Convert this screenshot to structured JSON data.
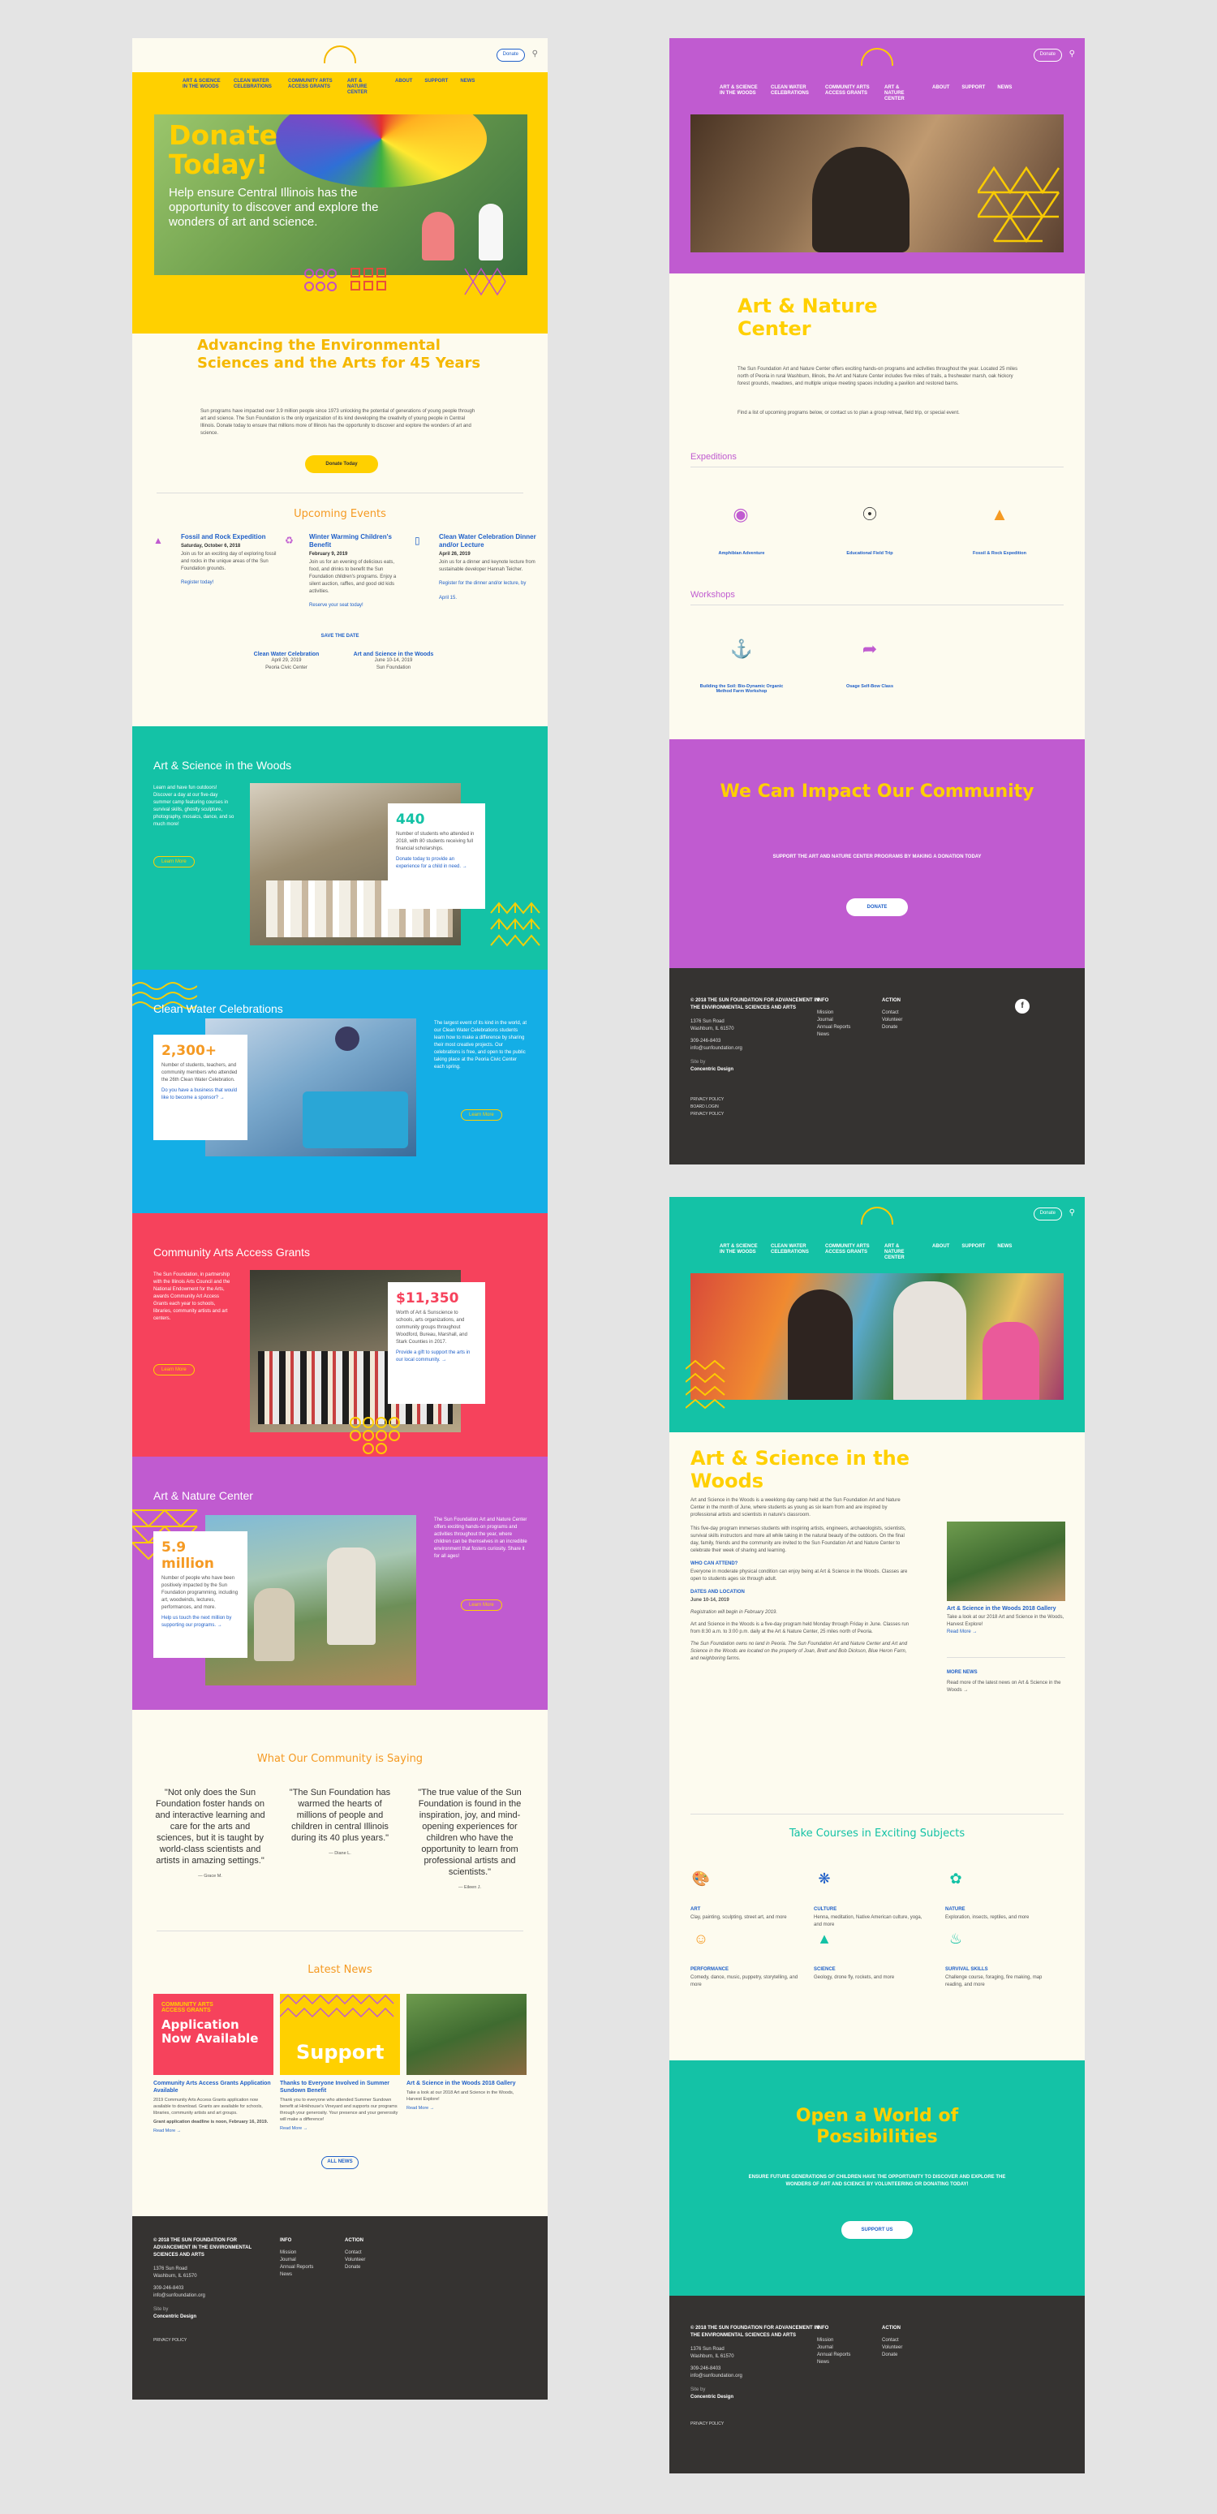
{
  "nav": [
    "Art & Science in the Woods",
    "Clean Water Celebrations",
    "Community Arts Access Grants",
    "Art & Nature Center",
    "About",
    "Support",
    "News"
  ],
  "header": {
    "donate": "Donate",
    "search_icon": "search-icon"
  },
  "p1": {
    "hero_title": "Donate Today!",
    "hero_text": "Help ensure Central Illinois has the opportunity to discover and explore the wonders of art and science.",
    "intro_title": "Advancing the Environmental Sciences and the Arts for 45 Years",
    "intro_text": "Sun programs have impacted over 3.9 million people since 1973 unlocking the potential of generations of young people through art and science. The Sun Foundation is the only organization of its kind developing the creativity of young people in Central Illinois. Donate today to ensure that millions more of Illinois has the opportunity to discover and explore the wonders of art and science.",
    "donate_button": "Donate Today",
    "events_title": "Upcoming Events",
    "events": [
      {
        "title": "Fossil and Rock Expedition",
        "date": "Saturday, October 6, 2018",
        "text": "Join us for an exciting day of exploring fossil and rocks in the unique areas of the Sun Foundation grounds.",
        "link": "Register today!"
      },
      {
        "title": "Winter Warming Children's Benefit",
        "date": "February 9, 2019",
        "text": "Join us for an evening of delicious eats, food, and drinks to benefit the Sun Foundation children's programs. Enjoy a silent auction, raffles, and good old kids activities.",
        "link": "Reserve your seat today!"
      },
      {
        "title": "Clean Water Celebration Dinner and/or Lecture",
        "date": "April 26, 2019",
        "text": "Join us for a dinner and keynote lecture from sustainable developer Hannah Teicher.",
        "link": "Register for the dinner and/or lecture, by April 15."
      }
    ],
    "save_date": "Save the Date",
    "dates": [
      {
        "title": "Clean Water Celebration",
        "date": "April 29, 2019",
        "place": "Peoria Civic Center"
      },
      {
        "title": "Art and Science in the Woods",
        "date": "June 10-14, 2019",
        "place": "Sun Foundation"
      }
    ],
    "band1": {
      "title": "Art & Science in the Woods",
      "text": "Learn and have fun outdoors! Discover a day at our five-day summer camp featuring courses in survival skills, ghostly sculpture, photography, mosaics, dance, and so much more!",
      "button": "Learn More",
      "stat": "440",
      "stat_text": "Number of students who attended in 2018, with 80 students receiving full financial scholarships.",
      "stat_link": "Donate today to provide an experience for a child in need. →"
    },
    "band2": {
      "title": "Clean Water Celebrations",
      "stat": "2,300+",
      "stat_text": "Number of students, teachers, and community members who attended the 26th Clean Water Celebration.",
      "stat_link": "Do you have a business that would like to become a sponsor? →",
      "text": "The largest event of its kind in the world, at our Clean Water Celebrations students learn how to make a difference by sharing their most creative projects. Our celebrations is free, and open to the public taking place at the Peoria Civic Center each spring.",
      "button": "Learn More"
    },
    "band3": {
      "title": "Community Arts Access Grants",
      "text": "The Sun Foundation, in partnership with the Illinois Arts Council and the National Endowment for the Arts, awards Community Art Access Grants each year to schools, libraries, community artists and art centers.",
      "button": "Learn More",
      "stat": "$11,350",
      "stat_text": "Worth of Art & Sunscience to schools, arts organizations, and community groups throughout Woodford, Bureau, Marshall, and Stark Counties in 2017.",
      "stat_link": "Provide a gift to support the arts in our local community. →"
    },
    "band4": {
      "title": "Art & Nature Center",
      "stat": "5.9 million",
      "stat_text": "Number of people who have been positively impacted by the Sun Foundation programming, including art, woodwinds, lectures, performances, and more.",
      "stat_link": "Help us touch the next million by supporting our programs. →",
      "text": "The Sun Foundation Art and Nature Center offers exciting hands-on programs and activities throughout the year, where children can be themselves in an incredible environment that fosters curiosity. Share it for all ages!",
      "button": "Learn More"
    },
    "community_title": "What Our Community is Saying",
    "quotes": [
      {
        "text": "\"Not only does the Sun Foundation foster hands on and interactive learning and care for the arts and sciences, but it is taught by world-class scientists and artists in amazing settings.\"",
        "by": "— Grace M."
      },
      {
        "text": "\"The Sun Foundation has warmed the hearts of millions of people and children in central Illinois during its 40 plus years.\"",
        "by": "— Diane L."
      },
      {
        "text": "\"The true value of the Sun Foundation is found in the inspiration, joy, and mind-opening experiences for children who have the opportunity to learn from professional artists and scientists.\"",
        "by": "— Eileen J."
      }
    ],
    "news_title": "Latest News",
    "news": [
      {
        "img_title": "Application Now Available",
        "img_kicker": "Community Arts Access Grants",
        "title": "Community Arts Access Grants Application Available",
        "text": "2019 Community Arts Access Grants application now available to download. Grants are available for schools, libraries, community artists and art groups.",
        "extra": "Grant application deadline is noon, February 16, 2019.",
        "link": "Read More →"
      },
      {
        "img_title": "Support",
        "title": "Thanks to Everyone Involved in Summer Sundown Benefit",
        "text": "Thank you to everyone who attended Summer Sundown benefit at Hinkhouse's Vineyard and supports our programs through your generosity. Your presence and your generosity will make a difference!",
        "link": "Read More →"
      },
      {
        "title": "Art & Science in the Woods 2018 Gallery",
        "text": "Take a look at our 2018 Art and Science in the Woods, Harvest Explore!",
        "link": "Read More →"
      }
    ],
    "all_news": "All News"
  },
  "footer": {
    "org": "© 2018 The Sun Foundation for Advancement in the Environmental Sciences and Arts",
    "address1": "1376 Sun Road",
    "address2": "Washburn, IL 61570",
    "phone": "309-246-8403",
    "email": "info@sunfoundation.org",
    "site_by": "Site by",
    "site_by_name": "Concentric Design",
    "info_title": "Info",
    "info": [
      "Mission",
      "Journal",
      "Annual Reports",
      "News"
    ],
    "action_title": "Action",
    "action": [
      "Contact",
      "Volunteer",
      "Donate"
    ],
    "privacy": "Privacy Policy",
    "board": "Board Login",
    "privacy2": "Privacy Policy"
  },
  "p2": {
    "title": "Art & Nature Center",
    "text": "The Sun Foundation Art and Nature Center offers exciting hands-on programs and activities throughout the year. Located 25 miles north of Peoria in rural Washburn, Illinois, the Art and Nature Center includes five miles of trails, a freshwater marsh, oak hickory forest grounds, meadows, and multiple unique meeting spaces including a pavilion and restored barns.",
    "text2": "Find a list of upcoming programs below, or contact us to plan a group retreat, field trip, or special event.",
    "exp_title": "Expeditions",
    "expeditions": [
      "Amphibian Adventure",
      "Educational Field Trip",
      "Fossil & Rock Expedition"
    ],
    "ws_title": "Workshops",
    "workshops": [
      "Building the Soil: Bio-Dynamic Organic Method Farm Workshop",
      "Osage Self-Bow Class"
    ],
    "cta_title": "We Can Impact Our Community",
    "cta_text": "Support the Art and Nature Center programs by making a donation today",
    "cta_button": "Donate"
  },
  "p3": {
    "title": "Art & Science in the Woods",
    "p1": "Art and Science in the Woods is a weeklong day camp held at the Sun Foundation Art and Nature Center in the month of June, where students as young as six learn from and are inspired by professional artists and scientists in nature's classroom.",
    "p2": "This five-day program immerses students with inspiring artists, engineers, archaeologists, scientists, survival skills instructors and more all while taking in the natural beauty of the outdoors. On the final day, family, friends and the community are invited to the Sun Foundation Art and Nature Center to celebrate their week of sharing and learning.",
    "who_title": "Who Can Attend?",
    "who": "Everyone in moderate physical condition can enjoy being at Art & Science in the Woods. Classes are open to students ages six through adult.",
    "dl_title": "Dates and Location",
    "dl_date": "June 10-14, 2019",
    "dl_reg": "Registration will begin in February 2019.",
    "dl_text": "Art and Science in the Woods is a five-day program held Monday through Friday in June. Classes run from 8:30 a.m. to 3:00 p.m. daily at the Art & Nature Center, 25 miles north of Peoria.",
    "dl_text2": "The Sun Foundation owns no land in Peoria. The Sun Foundation Art and Nature Center and Art and Science in the Woods are located on the property of Joan, Brett and Bob Dickson, Blue Heron Farm, and neighboring farms.",
    "side_title": "Art & Science in the Woods 2018 Gallery",
    "side_text": "Take a look at our 2018 Art and Science in the Woods, Harvest Explore!",
    "side_link": "Read More →",
    "more_title": "More News",
    "more_text": "Read more of the latest news on Art & Science in the Woods →",
    "courses_title": "Take Courses in Exciting Subjects",
    "courses": [
      {
        "name": "Art",
        "text": "Clay, painting, sculpting, street art, and more"
      },
      {
        "name": "Culture",
        "text": "Henna, meditation, Native American culture, yoga, and more"
      },
      {
        "name": "Nature",
        "text": "Exploration, insects, reptiles, and more"
      },
      {
        "name": "Performance",
        "text": "Comedy, dance, music, puppetry, storytelling, and more"
      },
      {
        "name": "Science",
        "text": "Geology, drone fly, rockets, and more"
      },
      {
        "name": "Survival Skills",
        "text": "Challenge course, foraging, fire making, map reading, and more"
      }
    ],
    "cta_title": "Open a World of Possibilities",
    "cta_text": "Ensure future generations of children have the opportunity to discover and explore the wonders of art and science by volunteering or donating today!",
    "cta_button": "Support Us"
  },
  "colors": {
    "yellow": "#ffd000",
    "teal": "#14c2a6",
    "blue": "#14aee6",
    "red": "#f6425c",
    "purple": "#c05bd0",
    "orange": "#f59a23",
    "dark": "#353331",
    "cream": "#fdfbef",
    "link": "#2060c8"
  }
}
